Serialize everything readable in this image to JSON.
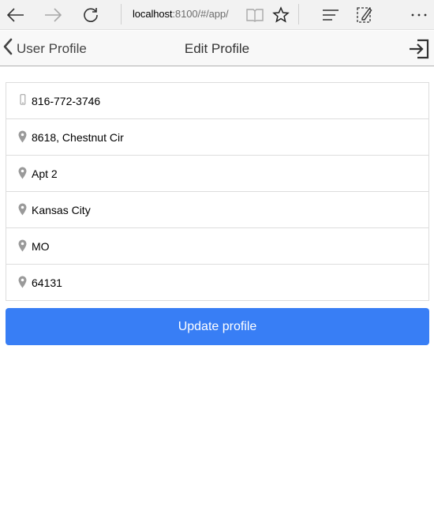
{
  "browser": {
    "url_host": "localhost",
    "url_rest": ":8100/#/app/",
    "icons": [
      "back-arrow-icon",
      "forward-arrow-icon",
      "refresh-icon",
      "reading-view-icon",
      "favorite-star-icon",
      "hub-icon",
      "web-note-icon",
      "more-icon"
    ]
  },
  "header": {
    "back_label": "User Profile",
    "title": "Edit Profile"
  },
  "form": {
    "fields": [
      {
        "icon": "phone-icon",
        "value": "816-772-3746"
      },
      {
        "icon": "location-pin-icon",
        "value": "8618, Chestnut Cir"
      },
      {
        "icon": "location-pin-icon",
        "value": "Apt 2"
      },
      {
        "icon": "location-pin-icon",
        "value": "Kansas City"
      },
      {
        "icon": "location-pin-icon",
        "value": "MO"
      },
      {
        "icon": "location-pin-icon",
        "value": "64131"
      }
    ]
  },
  "actions": {
    "update_label": "Update profile"
  },
  "colors": {
    "primary": "#387ef5",
    "icon_gray": "#9a9a9a"
  }
}
